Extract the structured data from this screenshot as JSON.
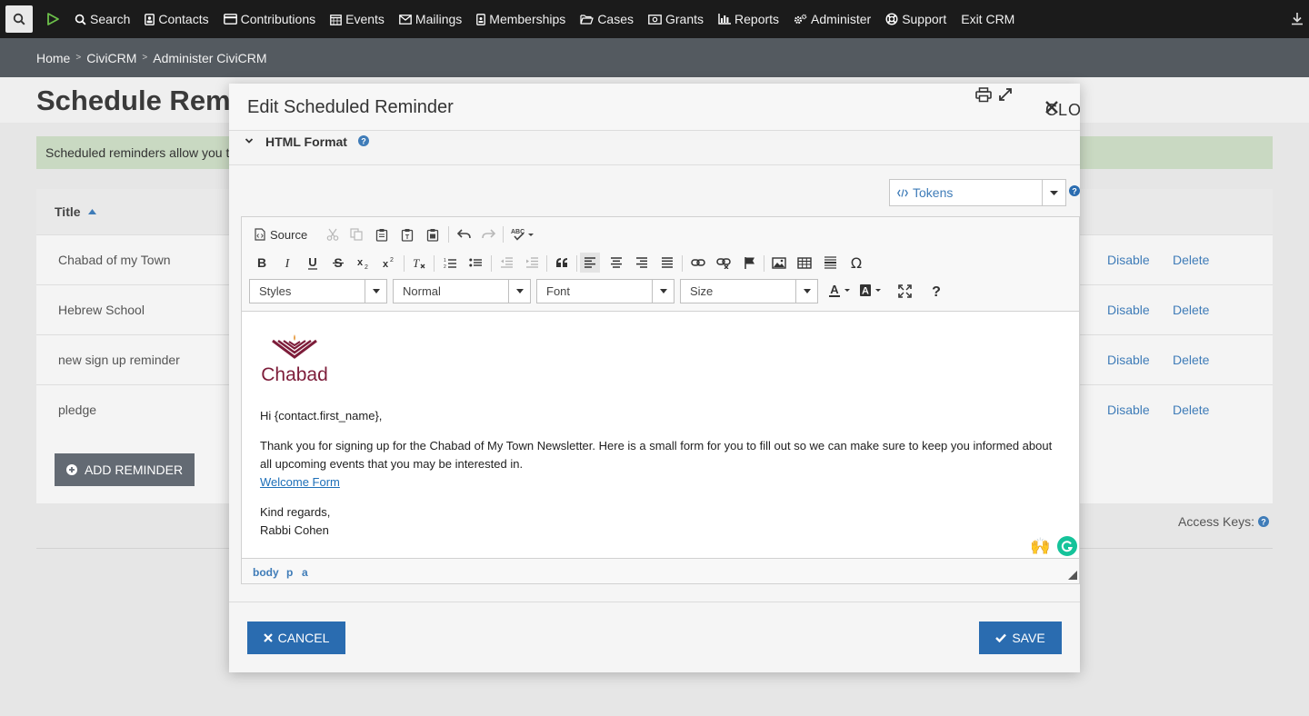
{
  "navbar": {
    "items": [
      {
        "label": "Search",
        "icon": "search-icon"
      },
      {
        "label": "Contacts",
        "icon": "contact-card-icon"
      },
      {
        "label": "Contributions",
        "icon": "credit-card-icon"
      },
      {
        "label": "Events",
        "icon": "calendar-icon"
      },
      {
        "label": "Mailings",
        "icon": "envelope-icon"
      },
      {
        "label": "Memberships",
        "icon": "id-badge-icon"
      },
      {
        "label": "Cases",
        "icon": "folder-open-icon"
      },
      {
        "label": "Grants",
        "icon": "money-icon"
      },
      {
        "label": "Reports",
        "icon": "bar-chart-icon"
      },
      {
        "label": "Administer",
        "icon": "cogs-icon"
      },
      {
        "label": "Support",
        "icon": "life-ring-icon"
      },
      {
        "label": "Exit CRM",
        "icon": ""
      }
    ]
  },
  "breadcrumb": [
    "Home",
    "CiviCRM",
    "Administer CiviCRM"
  ],
  "page": {
    "title": "Schedule Reminders",
    "help_text": "Scheduled reminders allow you to",
    "table_header": "Title",
    "rows": [
      {
        "title": "Chabad of my Town",
        "disable": "Disable",
        "delete": "Delete"
      },
      {
        "title": "Hebrew School",
        "disable": "Disable",
        "delete": "Delete"
      },
      {
        "title": "new sign up reminder",
        "disable": "Disable",
        "delete": "Delete"
      },
      {
        "title": "pledge",
        "disable": "Disable",
        "delete": "Delete"
      }
    ],
    "add_button": "Add Reminder",
    "access_keys": "Access Keys:"
  },
  "modal": {
    "title": "Edit Scheduled Reminder",
    "close_label": "Close",
    "section_label": "HTML Format",
    "tokens_label": "Tokens",
    "toolbar": {
      "source_label": "Source",
      "styles": "Styles",
      "format": "Normal",
      "font": "Font",
      "size": "Size"
    },
    "content": {
      "logo_text": "Chabad",
      "greeting": "Hi {contact.first_name},",
      "body_line1": "Thank you for signing up for the Chabad of My Town Newsletter. Here is a small form for you to fill out so we can make sure to keep you informed about",
      "body_line2": "all upcoming events that you may be interested in.",
      "link_text": "Welcome Form",
      "closing": "Kind regards,",
      "signature": "Rabbi Cohen"
    },
    "elements_path": [
      "body",
      "p",
      "a"
    ],
    "cancel_label": "Cancel",
    "save_label": "Save"
  },
  "colors": {
    "navbar_bg": "#1b1b1b",
    "breadcrumb_bg": "#545a60",
    "primary_button": "#2a6cb0",
    "link": "#3f7cb8",
    "help_banner": "#c9d9c2",
    "chabad_maroon": "#7d1d3a"
  }
}
